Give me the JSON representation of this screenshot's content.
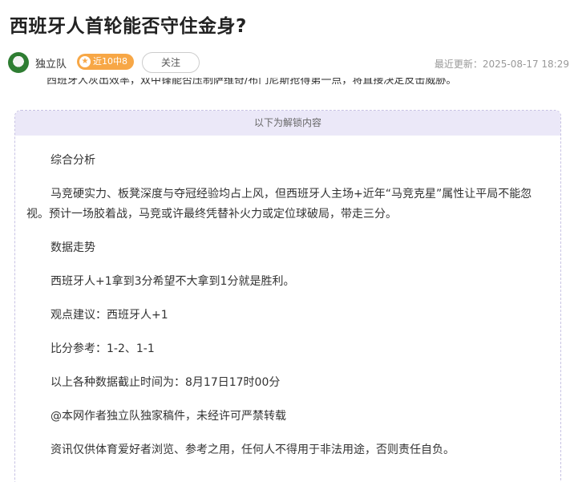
{
  "article": {
    "title": "西班牙人首轮能否守住金身?",
    "author": {
      "name": "独立队",
      "badge_icon": "★",
      "badge": "近10中8",
      "follow_label": "关注",
      "avatar_icon": "soccer-ball-avatar"
    },
    "updated": "最近更新：2025-08-17 18:29",
    "partial_line": "西班牙人灰出效率，双中锋能否压制萨维奇/布门尼斯抢得第一点，将直接决定反击威胁。"
  },
  "locked": {
    "header": "以下为解锁内容",
    "paragraphs": [
      "综合分析",
      "马竞硬实力、板凳深度与夺冠经验均占上风，但西班牙人主场+近年“马竞克星”属性让平局不能忽视。预计一场胶着战，马竞或许最终凭替补火力或定位球破局，带走三分。",
      "数据走势",
      "西班牙人+1拿到3分希望不大拿到1分就是胜利。",
      "观点建议：西班牙人+1",
      "比分参考：1-2、1-1",
      "以上各种数据截止时间为：8月17日17时00分",
      "@本网作者独立队独家稿件，未经许可严禁转载",
      "资讯仅供体育爱好者浏览、参考之用，任何人不得用于非法用途，否则责任自负。"
    ]
  },
  "colors": {
    "badge": "#f7a746",
    "locked_header_bg": "#ebe8f8",
    "locked_border": "#c7c2e3"
  }
}
